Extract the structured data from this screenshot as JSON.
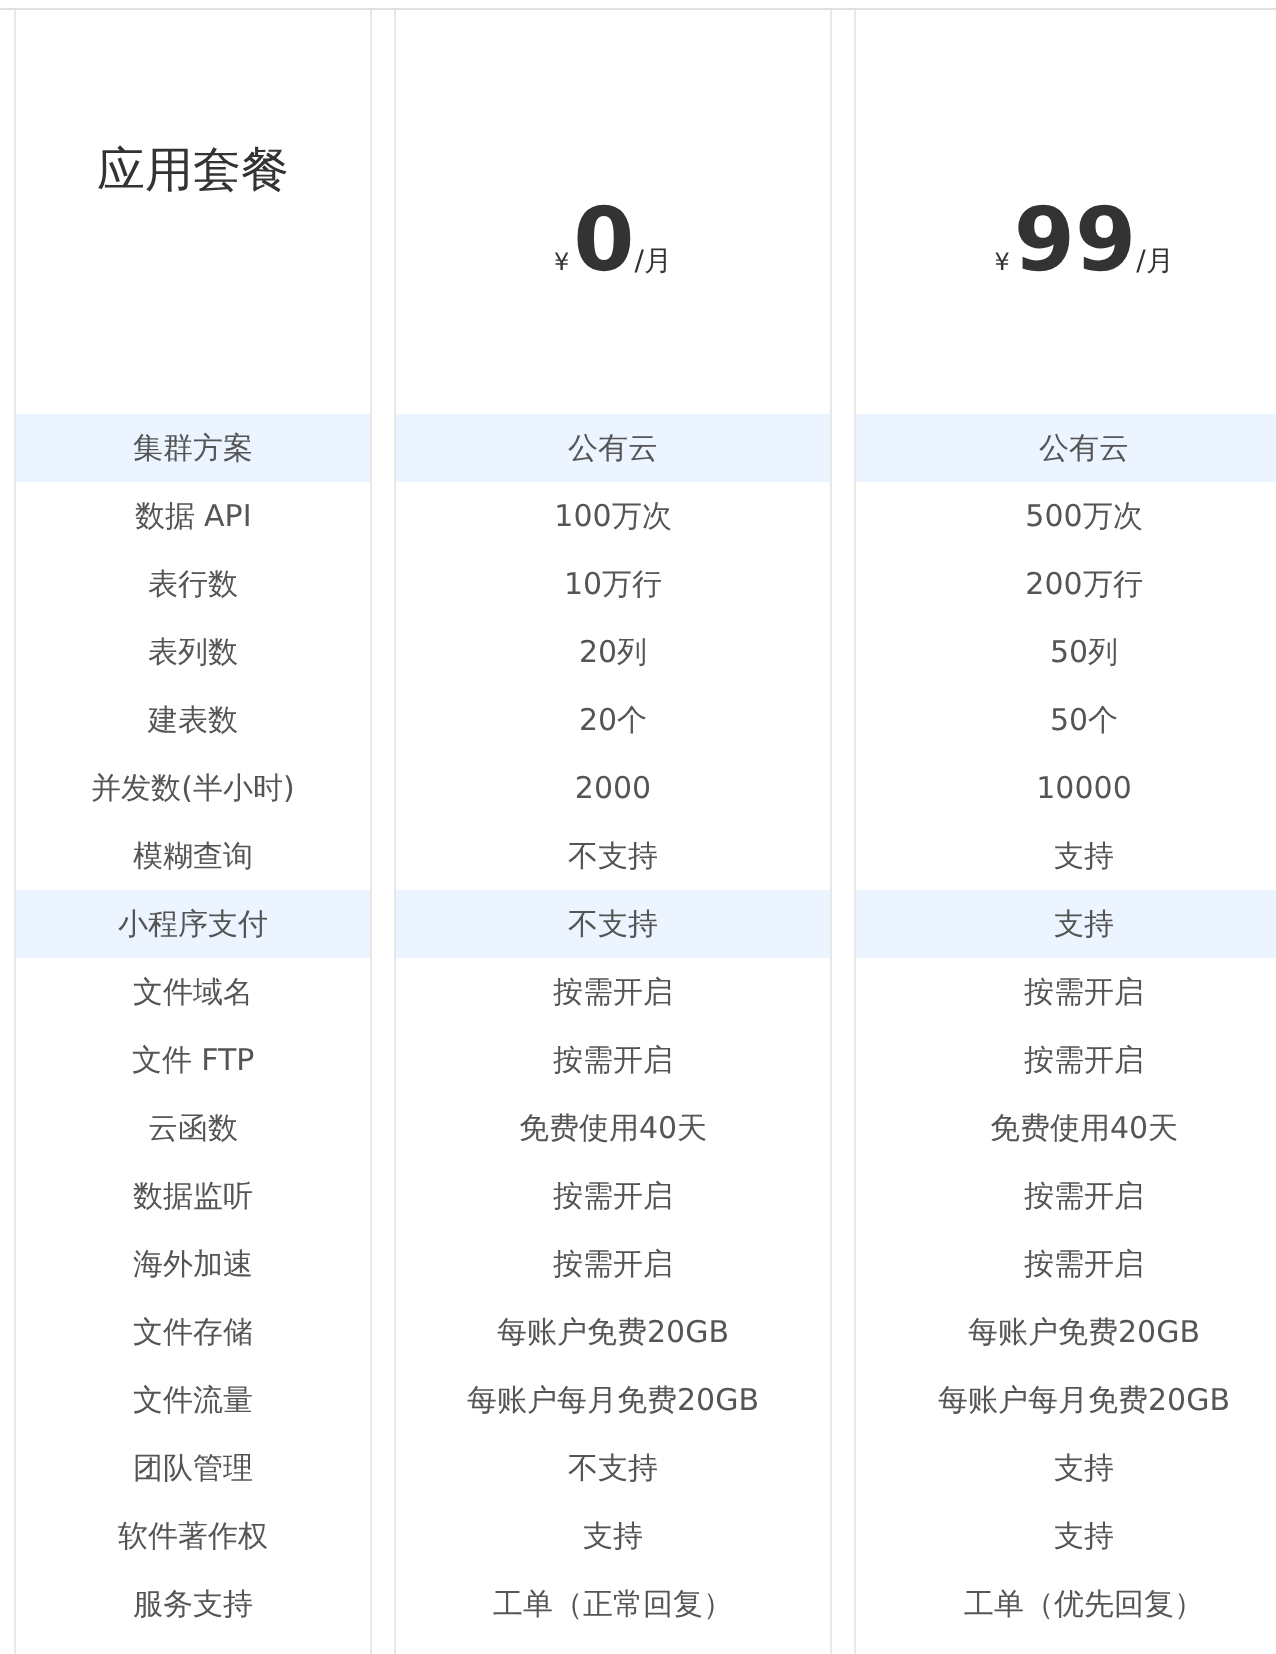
{
  "title": "应用套餐",
  "plans": [
    {
      "currency": "¥",
      "price": "0",
      "unit": "/月"
    },
    {
      "currency": "¥",
      "price": "99",
      "unit": "/月"
    }
  ],
  "rows": [
    {
      "label": "集群方案",
      "values": [
        "公有云",
        "公有云"
      ],
      "highlighted": true
    },
    {
      "label": "数据 API",
      "values": [
        "100万次",
        "500万次"
      ],
      "highlighted": false
    },
    {
      "label": "表行数",
      "values": [
        "10万行",
        "200万行"
      ],
      "highlighted": false
    },
    {
      "label": "表列数",
      "values": [
        "20列",
        "50列"
      ],
      "highlighted": false
    },
    {
      "label": "建表数",
      "values": [
        "20个",
        "50个"
      ],
      "highlighted": false
    },
    {
      "label": "并发数(半小时)",
      "values": [
        "2000",
        "10000"
      ],
      "highlighted": false
    },
    {
      "label": "模糊查询",
      "values": [
        "不支持",
        "支持"
      ],
      "highlighted": false
    },
    {
      "label": "小程序支付",
      "values": [
        "不支持",
        "支持"
      ],
      "highlighted": true
    },
    {
      "label": "文件域名",
      "values": [
        "按需开启",
        "按需开启"
      ],
      "highlighted": false
    },
    {
      "label": "文件 FTP",
      "values": [
        "按需开启",
        "按需开启"
      ],
      "highlighted": false
    },
    {
      "label": "云函数",
      "values": [
        "免费使用40天",
        "免费使用40天"
      ],
      "highlighted": false
    },
    {
      "label": "数据监听",
      "values": [
        "按需开启",
        "按需开启"
      ],
      "highlighted": false
    },
    {
      "label": "海外加速",
      "values": [
        "按需开启",
        "按需开启"
      ],
      "highlighted": false
    },
    {
      "label": "文件存储",
      "values": [
        "每账户免费20GB",
        "每账户免费20GB"
      ],
      "highlighted": false
    },
    {
      "label": "文件流量",
      "values": [
        "每账户每月免费20GB",
        "每账户每月免费20GB"
      ],
      "highlighted": false
    },
    {
      "label": "团队管理",
      "values": [
        "不支持",
        "支持"
      ],
      "highlighted": false
    },
    {
      "label": "软件著作权",
      "values": [
        "支持",
        "支持"
      ],
      "highlighted": false
    },
    {
      "label": "服务支持",
      "values": [
        "工单（正常回复）",
        "工单（优先回复）"
      ],
      "highlighted": false
    }
  ]
}
